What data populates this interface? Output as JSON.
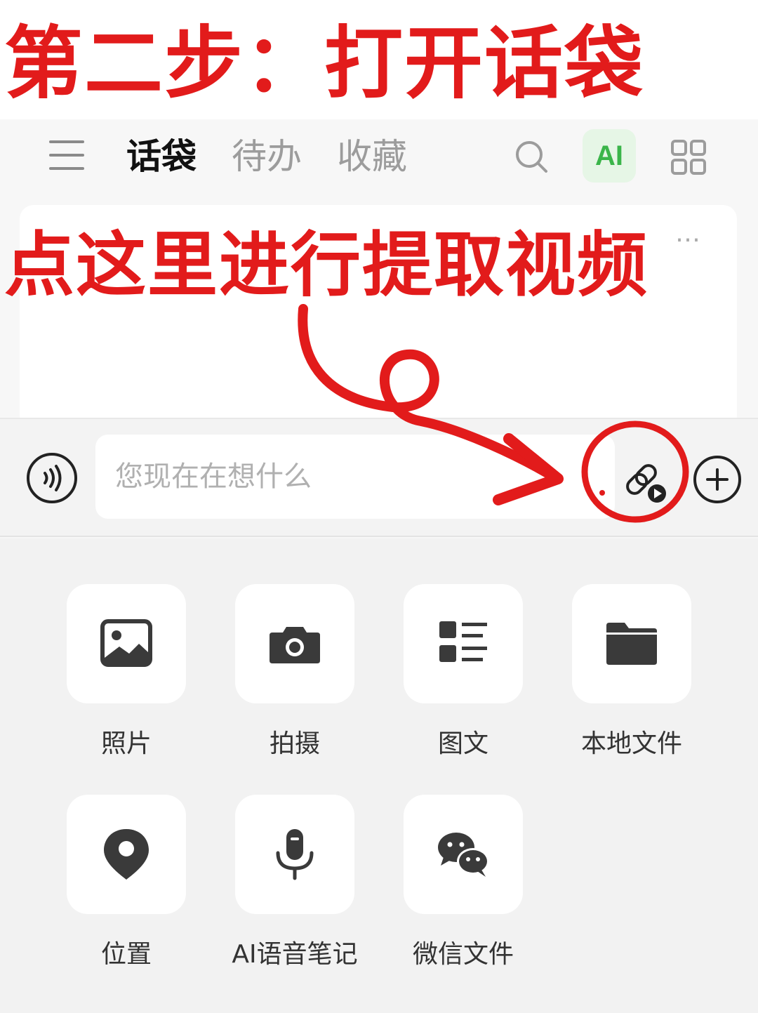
{
  "annotations": {
    "step_title": "第二步：打开话袋",
    "instruction": "点这里进行提取视频"
  },
  "header": {
    "menu_icon": "hamburger-menu-icon",
    "tabs": [
      {
        "label": "话袋",
        "active": true
      },
      {
        "label": "待办",
        "active": false
      },
      {
        "label": "收藏",
        "active": false
      }
    ],
    "ai_label": "AI",
    "search_icon": "search-icon",
    "grid_icon": "grid-icon"
  },
  "card": {
    "more": "…"
  },
  "input_bar": {
    "placeholder": "您现在在想什么",
    "voice_icon": "voice-icon",
    "link_video_icon": "link-video-icon",
    "add_icon": "plus-icon"
  },
  "tools": [
    {
      "label": "照片",
      "icon": "photo-icon"
    },
    {
      "label": "拍摄",
      "icon": "camera-icon"
    },
    {
      "label": "图文",
      "icon": "image-text-icon"
    },
    {
      "label": "本地文件",
      "icon": "folder-icon"
    },
    {
      "label": "位置",
      "icon": "location-pin-icon"
    },
    {
      "label": "AI语音笔记",
      "icon": "microphone-icon"
    },
    {
      "label": "微信文件",
      "icon": "wechat-icon"
    }
  ],
  "colors": {
    "annotation_red": "#e21b1b",
    "ai_green": "#3bb54a",
    "ai_bg": "#e6f6e6",
    "icon_dark": "#3a3a3a"
  }
}
